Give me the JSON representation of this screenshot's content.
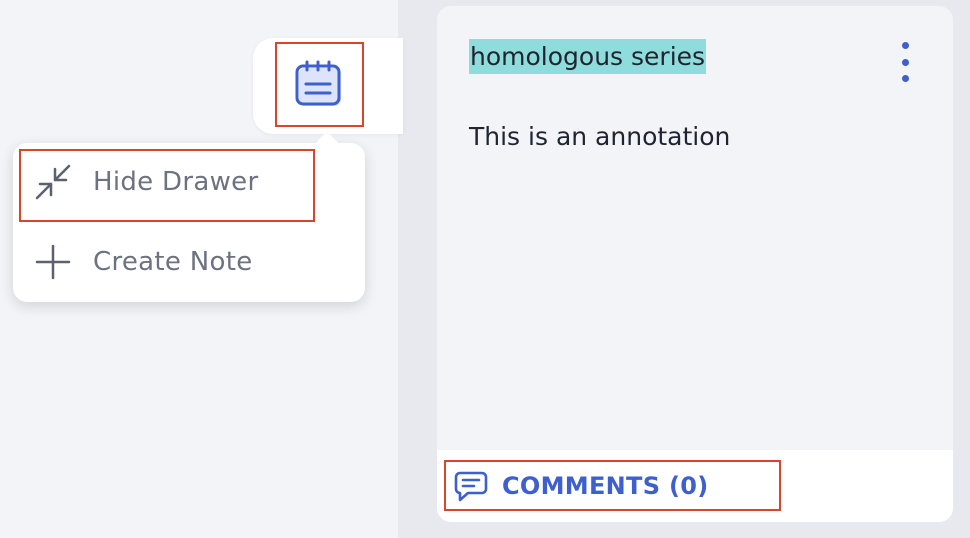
{
  "menu": {
    "items": [
      {
        "label": "Hide Drawer",
        "icon": "collapse-arrows-icon"
      },
      {
        "label": "Create Note",
        "icon": "plus-icon"
      }
    ]
  },
  "toggle": {
    "icon": "notepad-icon"
  },
  "annotation": {
    "title": "homologous series",
    "body": "This is an annotation",
    "comments_label": "COMMENTS (0)",
    "highlight_color": "#8fdcdc"
  },
  "colors": {
    "accent": "#3e5fce",
    "highlight_box": "#d9442c"
  }
}
